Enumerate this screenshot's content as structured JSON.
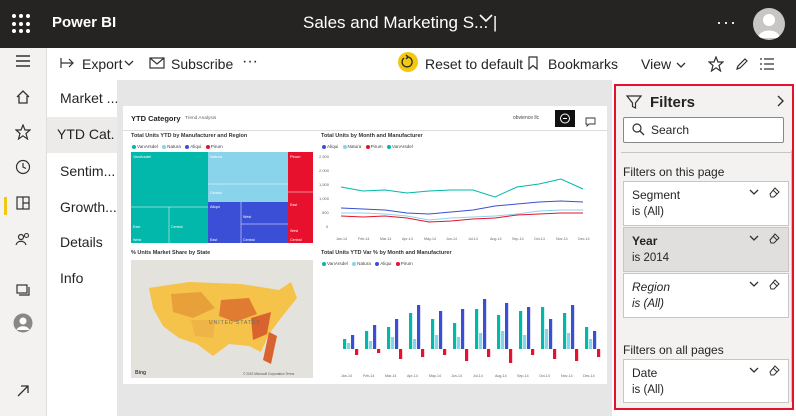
{
  "app": {
    "name": "Power BI",
    "report_title": "Sales and Marketing S...  |",
    "more": "···"
  },
  "toolbar": {
    "export_label": "Export",
    "subscribe_label": "Subscribe",
    "more": "···",
    "reset_label": "Reset to default",
    "bookmarks_label": "Bookmarks",
    "view_label": "View"
  },
  "pages": [
    "Market ...",
    "YTD Cat...",
    "Sentim...",
    "Growth...",
    "Details",
    "Info"
  ],
  "report": {
    "title": "YTD Category",
    "subtitle": "Trend Analysis",
    "brand": "obvience llc",
    "visuals": {
      "treemap": {
        "title": "Total Units YTD by Manufacturer and Region",
        "legend": [
          "VanArsdel",
          "Natura",
          "Aliqui",
          "Pirum"
        ],
        "tiles": [
          {
            "label": "VanArsdel",
            "color": "#01b8aa"
          },
          {
            "label": "Natura",
            "color": "#8ad4eb"
          },
          {
            "label": "Aliqui",
            "color": "#374649"
          },
          {
            "label": "Pirum",
            "color": "#e8112d"
          }
        ],
        "tile_labels": [
          "East",
          "Central",
          "West",
          "Central",
          "East",
          "East",
          "West",
          "Central",
          "West",
          "Central"
        ]
      },
      "line": {
        "title": "Total Units by Month and Manufacturer",
        "legend": [
          "Aliqui",
          "Natura",
          "Pirum",
          "VanArsdel"
        ],
        "yticks": [
          "2,500",
          "2,000",
          "1,500",
          "1,000",
          "500",
          "0"
        ],
        "xticks": [
          "Jan-14",
          "Feb-14",
          "Mar-14",
          "Apr-14",
          "May-14",
          "Jun-14",
          "Jul-14",
          "Aug-14",
          "Sep-14",
          "Oct-14",
          "Nov-14",
          "Dec-14"
        ]
      },
      "map": {
        "title": "% Units Market Share by State",
        "country_label": "UNITED STATES",
        "bing": "Bing",
        "copyright": "© 2019 Microsoft Corporation Terms"
      },
      "bar": {
        "title": "Total Units YTD Var % by Month and Manufacturer",
        "legend": [
          "VanArsdel",
          "Natura",
          "Aliqui",
          "Pirum"
        ],
        "xticks": [
          "Jan-14",
          "Feb-14",
          "Mar-14",
          "Apr-14",
          "May-14",
          "Jun-14",
          "Jul-14",
          "Aug-14",
          "Sep-14",
          "Oct-14",
          "Nov-14",
          "Dec-14"
        ]
      }
    }
  },
  "filters": {
    "title": "Filters",
    "search_placeholder": "Search",
    "page_section": "Filters on this page",
    "all_section": "Filters on all pages",
    "items": [
      {
        "name": "Segment",
        "value": "is (All)"
      },
      {
        "name": "Year",
        "value": "is 2014"
      },
      {
        "name": "Region",
        "value": "is (All)"
      },
      {
        "name": "Date",
        "value": "is (All)"
      }
    ]
  },
  "colors": {
    "topbar": "#252423",
    "accent_yellow": "#f2c811",
    "highlight_red": "#e8112d",
    "teal": "#01b8aa",
    "lightblue": "#8ad4eb",
    "blue": "#3a4fd6",
    "pink": "#fd625e"
  }
}
